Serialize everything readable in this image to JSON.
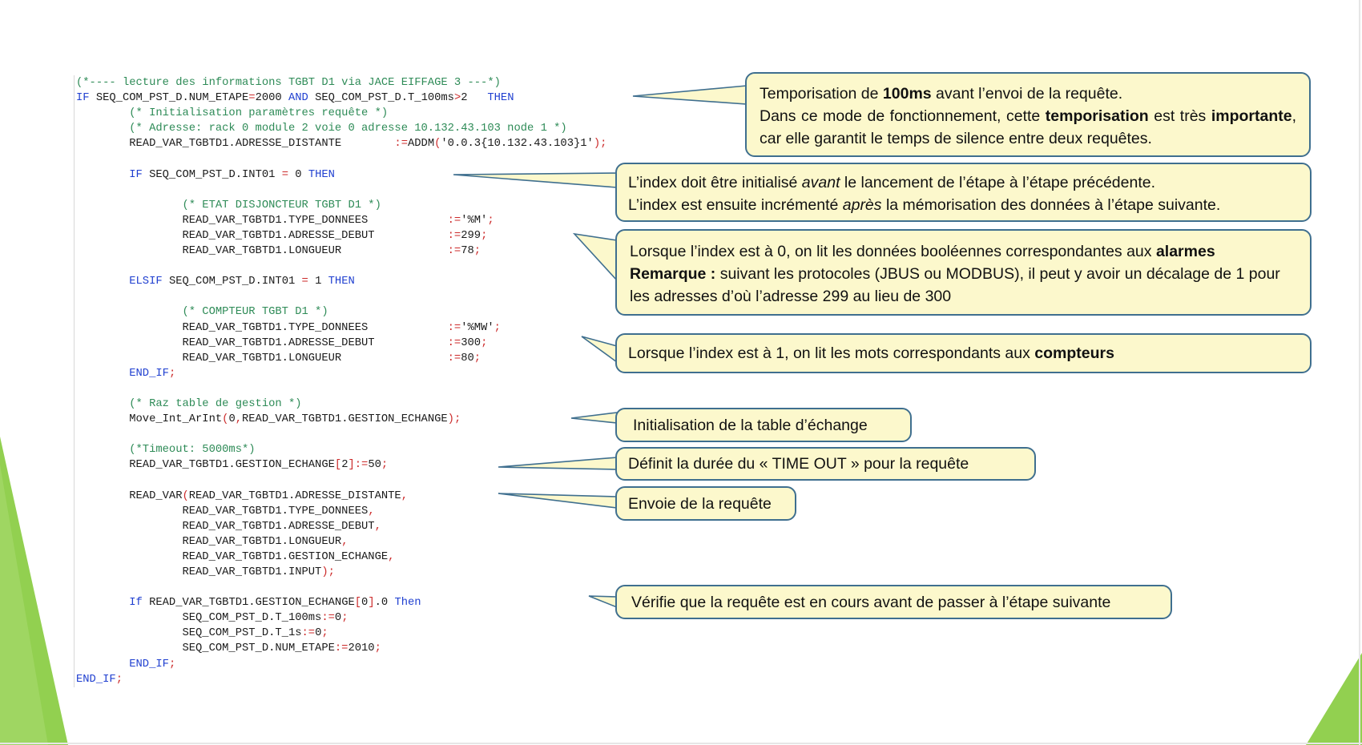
{
  "code_lines": [
    [
      {
        "t": "(*---- lecture des informations TGBT D1 via JACE EIFFAGE 3 ---*)",
        "c": "cm"
      }
    ],
    [
      {
        "t": "IF ",
        "c": "kw"
      },
      {
        "t": "SEQ_COM_PST_D.NUM_ETAPE",
        "c": "nm"
      },
      {
        "t": "=",
        "c": "op"
      },
      {
        "t": "2000 ",
        "c": "nm"
      },
      {
        "t": "AND ",
        "c": "kw"
      },
      {
        "t": "SEQ_COM_PST_D.T_100ms",
        "c": "nm"
      },
      {
        "t": ">",
        "c": "op"
      },
      {
        "t": "2   ",
        "c": "nm"
      },
      {
        "t": "THEN",
        "c": "kw"
      }
    ],
    [
      {
        "t": "        (* Initialisation paramètres requête *)",
        "c": "cm"
      }
    ],
    [
      {
        "t": "        (* Adresse: rack 0 module 2 voie 0 adresse 10.132.43.103 node 1 *)",
        "c": "cm"
      }
    ],
    [
      {
        "t": "        READ_VAR_TGBTD1.ADRESSE_DISTANTE        ",
        "c": "nm"
      },
      {
        "t": ":=",
        "c": "op"
      },
      {
        "t": "ADDM",
        "c": "nm"
      },
      {
        "t": "(",
        "c": "pu"
      },
      {
        "t": "'0.0.3{10.132.43.103}1'",
        "c": "st"
      },
      {
        "t": ");",
        "c": "pu"
      }
    ],
    [
      {
        "t": "",
        "c": "nm"
      }
    ],
    [
      {
        "t": "        ",
        "c": "nm"
      },
      {
        "t": "IF ",
        "c": "kw"
      },
      {
        "t": "SEQ_COM_PST_D.INT01 ",
        "c": "nm"
      },
      {
        "t": "= ",
        "c": "op"
      },
      {
        "t": "0 ",
        "c": "nm"
      },
      {
        "t": "THEN",
        "c": "kw"
      }
    ],
    [
      {
        "t": "",
        "c": "nm"
      }
    ],
    [
      {
        "t": "                (* ETAT DISJONCTEUR TGBT D1 *)",
        "c": "cm"
      }
    ],
    [
      {
        "t": "                READ_VAR_TGBTD1.TYPE_DONNEES            ",
        "c": "nm"
      },
      {
        "t": ":=",
        "c": "op"
      },
      {
        "t": "'%M'",
        "c": "st"
      },
      {
        "t": ";",
        "c": "pu"
      }
    ],
    [
      {
        "t": "                READ_VAR_TGBTD1.ADRESSE_DEBUT           ",
        "c": "nm"
      },
      {
        "t": ":=",
        "c": "op"
      },
      {
        "t": "299",
        "c": "nm"
      },
      {
        "t": ";",
        "c": "pu"
      }
    ],
    [
      {
        "t": "                READ_VAR_TGBTD1.LONGUEUR                ",
        "c": "nm"
      },
      {
        "t": ":=",
        "c": "op"
      },
      {
        "t": "78",
        "c": "nm"
      },
      {
        "t": ";",
        "c": "pu"
      }
    ],
    [
      {
        "t": "",
        "c": "nm"
      }
    ],
    [
      {
        "t": "        ",
        "c": "nm"
      },
      {
        "t": "ELSIF ",
        "c": "kw"
      },
      {
        "t": "SEQ_COM_PST_D.INT01 ",
        "c": "nm"
      },
      {
        "t": "= ",
        "c": "op"
      },
      {
        "t": "1 ",
        "c": "nm"
      },
      {
        "t": "THEN",
        "c": "kw"
      }
    ],
    [
      {
        "t": "",
        "c": "nm"
      }
    ],
    [
      {
        "t": "                (* COMPTEUR TGBT D1 *)",
        "c": "cm"
      }
    ],
    [
      {
        "t": "                READ_VAR_TGBTD1.TYPE_DONNEES            ",
        "c": "nm"
      },
      {
        "t": ":=",
        "c": "op"
      },
      {
        "t": "'%MW'",
        "c": "st"
      },
      {
        "t": ";",
        "c": "pu"
      }
    ],
    [
      {
        "t": "                READ_VAR_TGBTD1.ADRESSE_DEBUT           ",
        "c": "nm"
      },
      {
        "t": ":=",
        "c": "op"
      },
      {
        "t": "300",
        "c": "nm"
      },
      {
        "t": ";",
        "c": "pu"
      }
    ],
    [
      {
        "t": "                READ_VAR_TGBTD1.LONGUEUR                ",
        "c": "nm"
      },
      {
        "t": ":=",
        "c": "op"
      },
      {
        "t": "80",
        "c": "nm"
      },
      {
        "t": ";",
        "c": "pu"
      }
    ],
    [
      {
        "t": "        ",
        "c": "nm"
      },
      {
        "t": "END_IF",
        "c": "kw"
      },
      {
        "t": ";",
        "c": "pu"
      }
    ],
    [
      {
        "t": "",
        "c": "nm"
      }
    ],
    [
      {
        "t": "        (* Raz table de gestion *)",
        "c": "cm"
      }
    ],
    [
      {
        "t": "        Move_Int_ArInt",
        "c": "nm"
      },
      {
        "t": "(",
        "c": "pu"
      },
      {
        "t": "0",
        "c": "nm"
      },
      {
        "t": ",",
        "c": "pu"
      },
      {
        "t": "READ_VAR_TGBTD1.GESTION_ECHANGE",
        "c": "nm"
      },
      {
        "t": ");",
        "c": "pu"
      }
    ],
    [
      {
        "t": "",
        "c": "nm"
      }
    ],
    [
      {
        "t": "        (*Timeout: 5000ms*)",
        "c": "cm"
      }
    ],
    [
      {
        "t": "        READ_VAR_TGBTD1.GESTION_ECHANGE",
        "c": "nm"
      },
      {
        "t": "[",
        "c": "pu"
      },
      {
        "t": "2",
        "c": "nm"
      },
      {
        "t": "]",
        "c": "pu"
      },
      {
        "t": ":=",
        "c": "op"
      },
      {
        "t": "50",
        "c": "nm"
      },
      {
        "t": ";",
        "c": "pu"
      }
    ],
    [
      {
        "t": "",
        "c": "nm"
      }
    ],
    [
      {
        "t": "        READ_VAR",
        "c": "nm"
      },
      {
        "t": "(",
        "c": "pu"
      },
      {
        "t": "READ_VAR_TGBTD1.ADRESSE_DISTANTE",
        "c": "nm"
      },
      {
        "t": ",",
        "c": "pu"
      }
    ],
    [
      {
        "t": "                READ_VAR_TGBTD1.TYPE_DONNEES",
        "c": "nm"
      },
      {
        "t": ",",
        "c": "pu"
      }
    ],
    [
      {
        "t": "                READ_VAR_TGBTD1.ADRESSE_DEBUT",
        "c": "nm"
      },
      {
        "t": ",",
        "c": "pu"
      }
    ],
    [
      {
        "t": "                READ_VAR_TGBTD1.LONGUEUR",
        "c": "nm"
      },
      {
        "t": ",",
        "c": "pu"
      }
    ],
    [
      {
        "t": "                READ_VAR_TGBTD1.GESTION_ECHANGE",
        "c": "nm"
      },
      {
        "t": ",",
        "c": "pu"
      }
    ],
    [
      {
        "t": "                READ_VAR_TGBTD1.INPUT",
        "c": "nm"
      },
      {
        "t": ");",
        "c": "pu"
      }
    ],
    [
      {
        "t": "",
        "c": "nm"
      }
    ],
    [
      {
        "t": "        ",
        "c": "nm"
      },
      {
        "t": "If ",
        "c": "kw"
      },
      {
        "t": "READ_VAR_TGBTD1.GESTION_ECHANGE",
        "c": "nm"
      },
      {
        "t": "[",
        "c": "pu"
      },
      {
        "t": "0",
        "c": "nm"
      },
      {
        "t": "]",
        "c": "pu"
      },
      {
        "t": ".0 ",
        "c": "nm"
      },
      {
        "t": "Then",
        "c": "kw"
      }
    ],
    [
      {
        "t": "                SEQ_COM_PST_D.T_100ms",
        "c": "nm"
      },
      {
        "t": ":=",
        "c": "op"
      },
      {
        "t": "0",
        "c": "nm"
      },
      {
        "t": ";",
        "c": "pu"
      }
    ],
    [
      {
        "t": "                SEQ_COM_PST_D.T_1s",
        "c": "nm"
      },
      {
        "t": ":=",
        "c": "op"
      },
      {
        "t": "0",
        "c": "nm"
      },
      {
        "t": ";",
        "c": "pu"
      }
    ],
    [
      {
        "t": "                SEQ_COM_PST_D.NUM_ETAPE",
        "c": "nm"
      },
      {
        "t": ":=",
        "c": "op"
      },
      {
        "t": "2010",
        "c": "nm"
      },
      {
        "t": ";",
        "c": "pu"
      }
    ],
    [
      {
        "t": "        ",
        "c": "nm"
      },
      {
        "t": "END_IF",
        "c": "kw"
      },
      {
        "t": ";",
        "c": "pu"
      }
    ],
    [
      {
        "t": "END_IF",
        "c": "kw"
      },
      {
        "t": ";",
        "c": "pu"
      }
    ]
  ],
  "callouts": {
    "tempo": {
      "l1": [
        {
          "t": "Temporisation de "
        },
        {
          "t": "100ms",
          "b": true
        },
        {
          "t": " avant l’envoi de la requête."
        }
      ],
      "l2": [
        {
          "t": "Dans ce mode de fonctionnement, cette "
        },
        {
          "t": "temporisation",
          "b": true
        },
        {
          "t": " est très "
        },
        {
          "t": "importante",
          "b": true
        },
        {
          "t": ", car elle garantit le temps de silence entre deux requêtes."
        }
      ]
    },
    "index": {
      "l1": [
        {
          "t": "L’index doit être initialisé "
        },
        {
          "t": "avant",
          "i": true
        },
        {
          "t": " le lancement de l’étape à l’étape précédente."
        }
      ],
      "l2": [
        {
          "t": "L’index est ensuite incrémenté "
        },
        {
          "t": "après",
          "i": true
        },
        {
          "t": " la mémorisation des données à l’étape suivante."
        }
      ]
    },
    "index0": {
      "l1": [
        {
          "t": "Lorsque l’index est à 0, on lit les données booléennes correspondantes aux "
        },
        {
          "t": "alarmes",
          "b": true
        }
      ],
      "l2": [
        {
          "t": "Remarque :",
          "b": true
        },
        {
          "t": " suivant les protocoles (JBUS ou MODBUS), il peut y avoir un décalage de 1 pour les adresses d’où l’adresse 299 au lieu de 300"
        }
      ]
    },
    "index1": {
      "l1": [
        {
          "t": "Lorsque l’index est à 1, on lit les mots correspondants aux "
        },
        {
          "t": "compteurs",
          "b": true
        }
      ]
    },
    "init_table": "Initialisation de la table d’échange",
    "timeout": "Définit la durée du « TIME OUT » pour la requête",
    "send": "Envoie de la requête",
    "verify": "Vérifie que la requête est en cours avant de passer à l’étape suivante"
  },
  "colors": {
    "callout_fill": "#fcf8cc",
    "callout_border": "#3f6f8f",
    "accent_green": "#92d050",
    "comment": "#2e8b57",
    "keyword": "#1f3fd0",
    "operator": "#cc2a2a"
  }
}
